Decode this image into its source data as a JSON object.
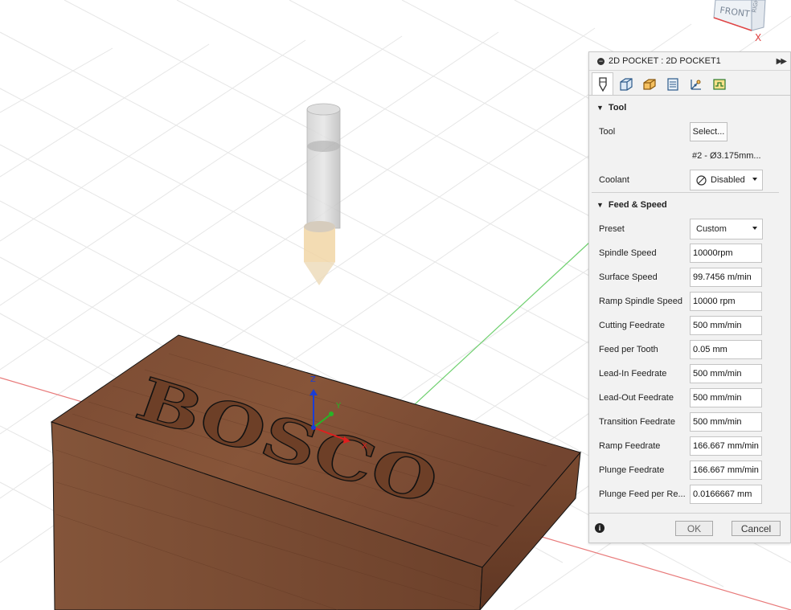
{
  "viewcube": {
    "front_label": "FRONT",
    "side_label": "RIGHT",
    "x_axis_label": "X"
  },
  "scene": {
    "sign_text": "BOSCO",
    "axis_z": "Z",
    "axis_y": "Y",
    "axis_x": "X"
  },
  "panel": {
    "title": "2D POCKET : 2D POCKET1",
    "tabs": [
      {
        "name": "tool-tab",
        "icon": "tool-icon"
      },
      {
        "name": "geometry-tab",
        "icon": "geometry-icon"
      },
      {
        "name": "heights-tab",
        "icon": "heights-icon"
      },
      {
        "name": "passes-tab",
        "icon": "passes-icon"
      },
      {
        "name": "linking-tab",
        "icon": "linking-icon"
      },
      {
        "name": "simulation-tab",
        "icon": "simulation-icon"
      }
    ],
    "tool_section": {
      "heading": "Tool",
      "tool_label": "Tool",
      "select_label": "Select...",
      "tool_name": "#2 - Ø3.175mm...",
      "coolant_label": "Coolant",
      "coolant_value": "Disabled"
    },
    "feed_section": {
      "heading": "Feed & Speed",
      "preset_label": "Preset",
      "preset_value": "Custom",
      "fields": [
        {
          "label": "Spindle Speed",
          "value": "10000rpm"
        },
        {
          "label": "Surface Speed",
          "value": "99.7456 m/min"
        },
        {
          "label": "Ramp Spindle Speed",
          "value": "10000 rpm"
        },
        {
          "label": "Cutting Feedrate",
          "value": "500 mm/min"
        },
        {
          "label": "Feed per Tooth",
          "value": "0.05 mm"
        },
        {
          "label": "Lead-In Feedrate",
          "value": "500 mm/min"
        },
        {
          "label": "Lead-Out Feedrate",
          "value": "500 mm/min"
        },
        {
          "label": "Transition Feedrate",
          "value": "500 mm/min"
        },
        {
          "label": "Ramp Feedrate",
          "value": "166.667 mm/min"
        },
        {
          "label": "Plunge Feedrate",
          "value": "166.667 mm/min"
        },
        {
          "label": "Plunge Feed per Re...",
          "value": "0.0166667 mm"
        }
      ]
    },
    "ok_label": "OK",
    "cancel_label": "Cancel"
  },
  "colors": {
    "wood": "#7a4a32",
    "wood_side": "#6a3d28",
    "grid_x_axis": "#e66a6a",
    "grid_y_axis": "#5ec95e",
    "tool_tip": "#f3d7a8",
    "panel_bg": "#f2f2f2"
  }
}
